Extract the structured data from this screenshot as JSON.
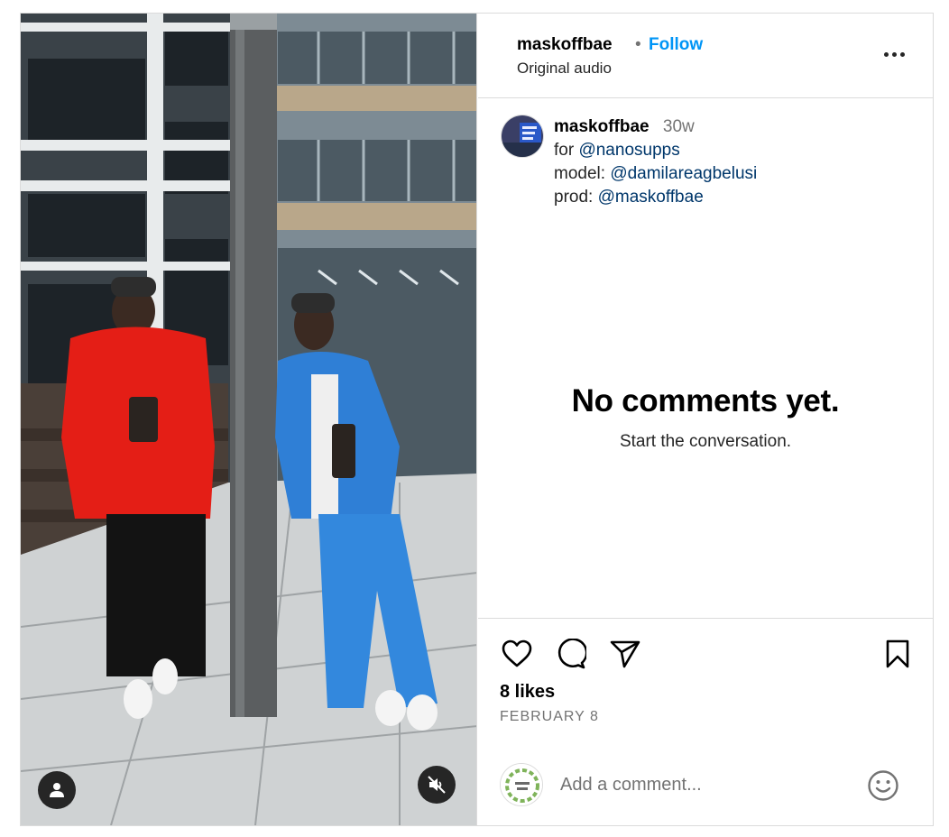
{
  "post": {
    "username": "maskoffbae",
    "follow_label": "Follow",
    "separator": "•",
    "audio": "Original audio",
    "more_icon": "more-horizontal-icon"
  },
  "caption": {
    "username": "maskoffbae",
    "time": "30w",
    "lines": [
      {
        "prefix": "for ",
        "mention": "@nanosupps"
      },
      {
        "prefix": "model: ",
        "mention": "@damilareagbelusi"
      },
      {
        "prefix": "prod: ",
        "mention": "@maskoffbae"
      }
    ]
  },
  "comments": {
    "empty_title": "No comments yet.",
    "empty_subtitle": "Start the conversation."
  },
  "actions": {
    "like_icon": "heart-icon",
    "comment_icon": "comment-bubble-icon",
    "share_icon": "share-paper-plane-icon",
    "save_icon": "bookmark-icon"
  },
  "likes": "8 likes",
  "date": "FEBRUARY 8",
  "comment_box": {
    "placeholder": "Add a comment...",
    "emoji_icon": "emoji-smiley-icon"
  },
  "media": {
    "tagged_users_icon": "user-icon",
    "mute_icon": "speaker-muted-icon"
  },
  "colors": {
    "accent": "#0095f6",
    "mention": "#00376b",
    "muted_text": "#737373",
    "border": "#dbdbdb"
  }
}
